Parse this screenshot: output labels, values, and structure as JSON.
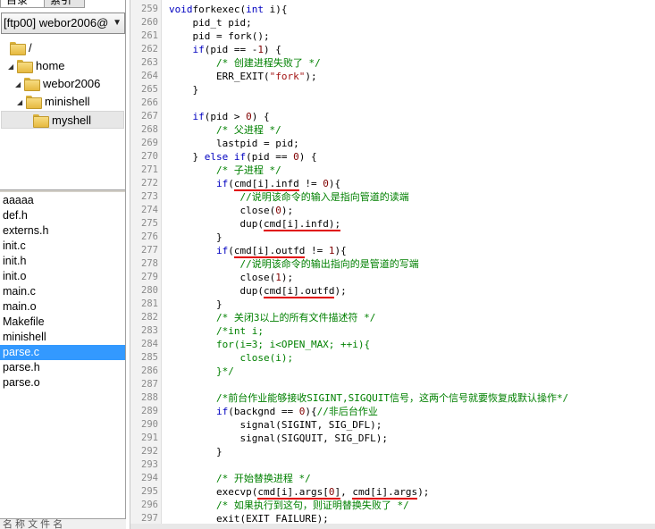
{
  "left": {
    "tabs": [
      "目录",
      "索引"
    ],
    "ftp_select": "[ftp00] webor2006@",
    "tree": [
      {
        "label": "/",
        "depth": 0,
        "expander": ""
      },
      {
        "label": "home",
        "depth": 1,
        "expander": "◢"
      },
      {
        "label": "webor2006",
        "depth": 2,
        "expander": "◢"
      },
      {
        "label": "minishell",
        "depth": 3,
        "expander": "◢"
      },
      {
        "label": "myshell",
        "depth": 4,
        "expander": "",
        "selected": true
      }
    ],
    "files": [
      "aaaaa",
      "def.h",
      "externs.h",
      "init.c",
      "init.h",
      "init.o",
      "main.c",
      "main.o",
      "Makefile",
      "minishell",
      "parse.c",
      "parse.h",
      "parse.o"
    ],
    "selected_file": "parse.c",
    "status_stub": "名 称 文 件 名"
  },
  "editor": {
    "lines": [
      {
        "n": "259",
        "segs": [
          [
            "kw",
            "void"
          ],
          [
            "",
            "forkexec("
          ],
          [
            "kw",
            "int"
          ],
          [
            "",
            " i){"
          ]
        ]
      },
      {
        "n": "260",
        "segs": [
          [
            "",
            "    pid_t pid;"
          ]
        ]
      },
      {
        "n": "261",
        "segs": [
          [
            "",
            "    pid = fork();"
          ]
        ]
      },
      {
        "n": "262",
        "segs": [
          [
            "kw",
            "    if"
          ],
          [
            "",
            "(pid == -"
          ],
          [
            "nm",
            "1"
          ],
          [
            "",
            ") {"
          ]
        ]
      },
      {
        "n": "263",
        "segs": [
          [
            "cm",
            "        /* 创建进程失败了 */"
          ]
        ]
      },
      {
        "n": "264",
        "segs": [
          [
            "",
            "        ERR_EXIT("
          ],
          [
            "st",
            "\"fork\""
          ],
          [
            "",
            ");"
          ]
        ]
      },
      {
        "n": "265",
        "segs": [
          [
            "",
            "    }"
          ]
        ]
      },
      {
        "n": "266",
        "segs": [
          [
            "",
            ""
          ]
        ]
      },
      {
        "n": "267",
        "segs": [
          [
            "kw",
            "    if"
          ],
          [
            "",
            "(pid > "
          ],
          [
            "nm",
            "0"
          ],
          [
            "",
            ") {"
          ]
        ]
      },
      {
        "n": "268",
        "segs": [
          [
            "cm",
            "        /* 父进程 */"
          ]
        ]
      },
      {
        "n": "269",
        "segs": [
          [
            "",
            "        lastpid = pid;"
          ]
        ]
      },
      {
        "n": "270",
        "segs": [
          [
            "",
            "    } "
          ],
          [
            "kw",
            "else if"
          ],
          [
            "",
            "(pid == "
          ],
          [
            "nm",
            "0"
          ],
          [
            "",
            ") {"
          ]
        ]
      },
      {
        "n": "271",
        "segs": [
          [
            "cm",
            "        /* 子进程 */"
          ]
        ]
      },
      {
        "n": "272",
        "segs": [
          [
            "kw",
            "        if"
          ],
          [
            "",
            "("
          ],
          [
            "ul",
            "cmd[i].infd"
          ],
          [
            "",
            " != "
          ],
          [
            "nm",
            "0"
          ],
          [
            "",
            "){"
          ]
        ]
      },
      {
        "n": "273",
        "segs": [
          [
            "cm",
            "            //说明该命令的输入是指向管道的读端"
          ]
        ]
      },
      {
        "n": "274",
        "segs": [
          [
            "",
            "            close("
          ],
          [
            "nm",
            "0"
          ],
          [
            "",
            ");"
          ]
        ]
      },
      {
        "n": "275",
        "segs": [
          [
            "",
            "            dup("
          ],
          [
            "ul",
            "cmd[i].infd);"
          ]
        ]
      },
      {
        "n": "276",
        "segs": [
          [
            "",
            "        }"
          ]
        ]
      },
      {
        "n": "277",
        "segs": [
          [
            "kw",
            "        if"
          ],
          [
            "",
            "("
          ],
          [
            "ul",
            "cmd[i].outfd"
          ],
          [
            "",
            " != "
          ],
          [
            "nm",
            "1"
          ],
          [
            "",
            "){"
          ]
        ]
      },
      {
        "n": "278",
        "segs": [
          [
            "cm",
            "            //说明该命令的输出指向的是管道的写端"
          ]
        ]
      },
      {
        "n": "279",
        "segs": [
          [
            "",
            "            close("
          ],
          [
            "nm",
            "1"
          ],
          [
            "",
            ");"
          ]
        ]
      },
      {
        "n": "280",
        "segs": [
          [
            "",
            "            dup("
          ],
          [
            "ul",
            "cmd[i].outfd"
          ],
          [
            "",
            ");"
          ]
        ]
      },
      {
        "n": "281",
        "segs": [
          [
            "",
            "        }"
          ]
        ]
      },
      {
        "n": "282",
        "segs": [
          [
            "cm",
            "        /* 关闭3以上的所有文件描述符 */"
          ]
        ]
      },
      {
        "n": "283",
        "segs": [
          [
            "cm",
            "        /*int i;"
          ]
        ]
      },
      {
        "n": "284",
        "segs": [
          [
            "cm",
            "        for(i=3; i<OPEN_MAX; ++i){"
          ]
        ]
      },
      {
        "n": "285",
        "segs": [
          [
            "cm",
            "            close(i);"
          ]
        ]
      },
      {
        "n": "286",
        "segs": [
          [
            "cm",
            "        }*/"
          ]
        ]
      },
      {
        "n": "287",
        "segs": [
          [
            "",
            ""
          ]
        ]
      },
      {
        "n": "288",
        "segs": [
          [
            "cm",
            "        /*前台作业能够接收SIGINT,SIGQUIT信号，这两个信号就要恢复成默认操作*/"
          ]
        ]
      },
      {
        "n": "289",
        "segs": [
          [
            "kw",
            "        if"
          ],
          [
            "",
            "(backgnd == "
          ],
          [
            "nm",
            "0"
          ],
          [
            "",
            "){"
          ],
          [
            "cm",
            "//非后台作业"
          ]
        ]
      },
      {
        "n": "290",
        "segs": [
          [
            "",
            "            signal(SIGINT, SIG_DFL);"
          ]
        ]
      },
      {
        "n": "291",
        "segs": [
          [
            "",
            "            signal(SIGQUIT, SIG_DFL);"
          ]
        ]
      },
      {
        "n": "292",
        "segs": [
          [
            "",
            "        }"
          ]
        ]
      },
      {
        "n": "293",
        "segs": [
          [
            "",
            ""
          ]
        ]
      },
      {
        "n": "294",
        "segs": [
          [
            "cm",
            "        /* 开始替换进程 */"
          ]
        ]
      },
      {
        "n": "295",
        "segs": [
          [
            "",
            "        execvp("
          ],
          [
            "ul",
            "cmd[i].args["
          ],
          [
            "ul nm",
            "0"
          ],
          [
            "ul",
            "]"
          ],
          [
            "",
            ", "
          ],
          [
            "ul",
            "cmd[i].args"
          ],
          [
            "",
            ");"
          ]
        ]
      },
      {
        "n": "296",
        "segs": [
          [
            "cm",
            "        /* 如果执行到这句，则证明替换失败了 */"
          ]
        ]
      },
      {
        "n": "297",
        "segs": [
          [
            "",
            "        exit(EXIT_FAILURE);"
          ]
        ]
      }
    ]
  },
  "colors": {
    "keyword": "#0000c0",
    "comment": "#008000",
    "string": "#a31515",
    "number": "#800000",
    "underline": "#e00000",
    "selection": "#3399ff"
  }
}
